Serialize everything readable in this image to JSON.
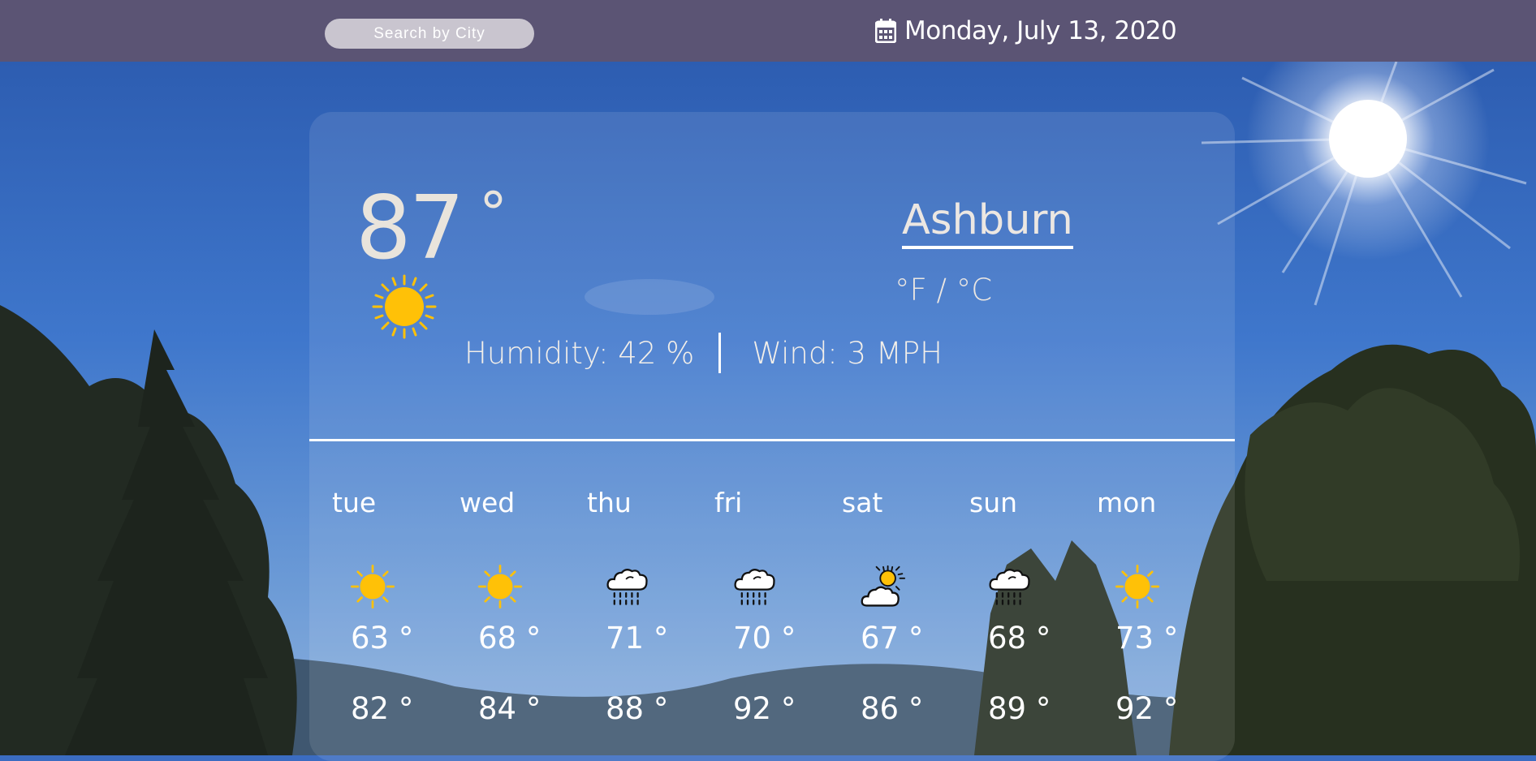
{
  "header": {
    "search_placeholder": "Search by City",
    "date": "Monday, July 13, 2020",
    "calendar_icon": "calendar-icon"
  },
  "current": {
    "temperature": "87",
    "degree_symbol": "°",
    "condition_icon": "sun-icon",
    "city": "Ashburn",
    "unit_toggle": "°F / °C",
    "humidity": "Humidity: 42 %",
    "wind": "Wind: 3 MPH"
  },
  "forecast": [
    {
      "day": "tue",
      "icon": "sun-icon",
      "low": "63 °",
      "high": "82 °"
    },
    {
      "day": "wed",
      "icon": "sun-icon",
      "low": "68 °",
      "high": "84 °"
    },
    {
      "day": "thu",
      "icon": "rain-cloud-icon",
      "low": "71 °",
      "high": "88 °"
    },
    {
      "day": "fri",
      "icon": "rain-cloud-icon",
      "low": "70 °",
      "high": "92 °"
    },
    {
      "day": "sat",
      "icon": "partly-cloudy-icon",
      "low": "67 °",
      "high": "86 °"
    },
    {
      "day": "sun",
      "icon": "rain-cloud-icon",
      "low": "68 °",
      "high": "89 °"
    },
    {
      "day": "mon",
      "icon": "sun-icon",
      "low": "73 °",
      "high": "92 °"
    }
  ],
  "colors": {
    "topbar": "#5b5474",
    "sun": "#ffc107",
    "sky": "#3b6cc1"
  }
}
